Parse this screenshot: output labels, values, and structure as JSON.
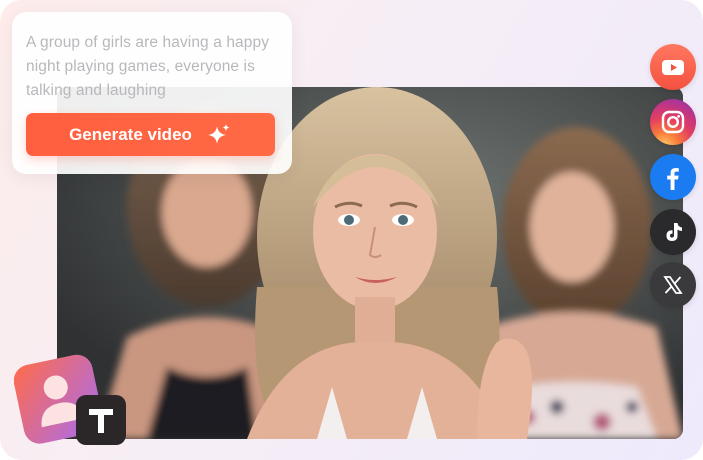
{
  "prompt": {
    "text": "A group of girls are having a happy night playing games, everyone is talking and laughing"
  },
  "generate_button": {
    "label": "Generate video",
    "icon": "sparkle-icon"
  },
  "social_links": [
    {
      "name": "youtube-icon",
      "color": "#f4513f"
    },
    {
      "name": "instagram-icon",
      "color": "#c13584"
    },
    {
      "name": "facebook-icon",
      "color": "#1b7cf2"
    },
    {
      "name": "tiktok-icon",
      "color": "#2a2a2c"
    },
    {
      "name": "x-icon",
      "color": "#3a3a3c"
    }
  ],
  "colors": {
    "accent": "#ff5f3f"
  }
}
